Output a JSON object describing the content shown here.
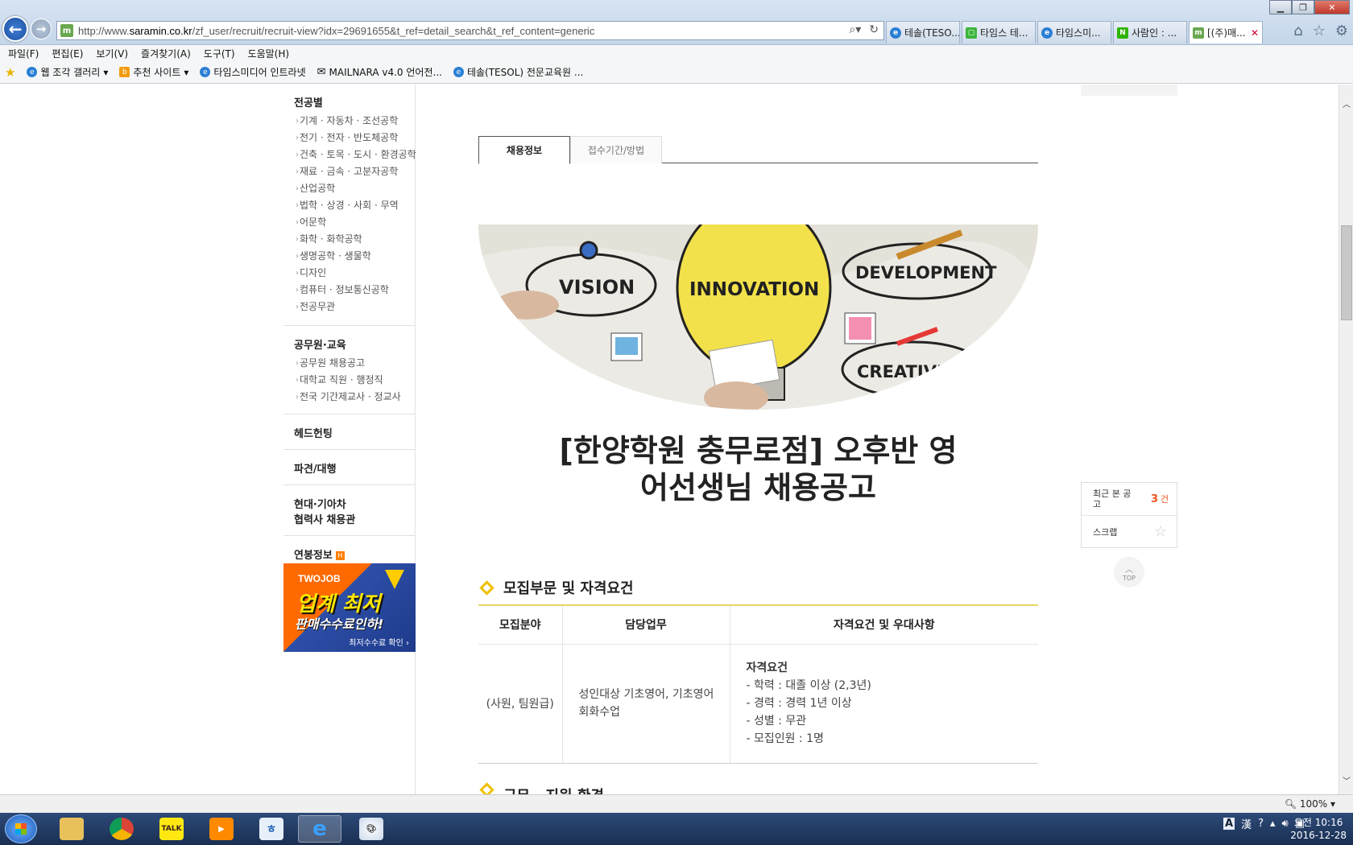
{
  "browser": {
    "url_prefix": "http://www.",
    "url_domain": "saramin.co.kr",
    "url_path": "/zf_user/recruit/recruit-view?idx=29691655&t_ref=detail_search&t_ref_content=generic",
    "tabs": [
      {
        "label": "테솔(TESO...",
        "icon": "ie-icon",
        "active": false
      },
      {
        "label": "타임스 테...",
        "icon": "line-icon",
        "active": false
      },
      {
        "label": "타임스미...",
        "icon": "ie-icon",
        "active": false
      },
      {
        "label": "사람인 : ...",
        "icon": "naver-icon",
        "active": false
      },
      {
        "label": "[(주)매...",
        "icon": "saramin-icon",
        "active": true
      }
    ],
    "menu": [
      "파일(F)",
      "편집(E)",
      "보기(V)",
      "즐겨찾기(A)",
      "도구(T)",
      "도움말(H)"
    ],
    "favorites": [
      "웹 조각 갤러리",
      "추천 사이트",
      "타임스미디어 인트라넷",
      "MAILNARA v4.0  언어전...",
      "테솔(TESOL) 전문교육원 ..."
    ],
    "zoom": "100%"
  },
  "sidebar": {
    "major_head": "전공별",
    "majors": [
      "기계 · 자동차 · 조선공학",
      "전기 · 전자 · 반도체공학",
      "건축 · 토목 · 도시 · 환경공학",
      "재료 · 금속 · 고분자공학",
      "산업공학",
      "법학 · 상경 · 사회 · 무역",
      "어문학",
      "화학 · 화학공학",
      "생명공학 · 생물학",
      "디자인",
      "컴퓨터 · 정보통신공학",
      "전공무관"
    ],
    "gov_head": "공무원·교육",
    "gov": [
      "공무원 채용공고",
      "대학교 직원 · 행정직",
      "전국 기간제교사 · 정교사"
    ],
    "headhunting": "헤드헌팅",
    "dispatch": "파견/대행",
    "hyundai_line1": "현대·기아차",
    "hyundai_line2": "협력사 채용관",
    "salary": "연봉정보",
    "salary_badge": "H",
    "ad": {
      "brand": "TWOJOB",
      "line1": "업계 최저",
      "line2": "판매수수료인하!",
      "link": "최저수수료 확인 ›"
    }
  },
  "main": {
    "tabs": [
      "채용정보",
      "접수기간/방법"
    ],
    "hero_words": [
      "VISION",
      "INNOVATION",
      "DEVELOPMENT",
      "CREATIVITY"
    ],
    "title_line1": "[한양학원 충무로점] 오후반 영",
    "title_line2": "어선생님 채용공고",
    "section_title": "모집부문 및 자격요건",
    "table": {
      "headers": [
        "모집분야",
        "담당업무",
        "자격요건 및 우대사항"
      ],
      "field": "(사원, 팀원급)",
      "duty_line1": "성인대상 기초영어, 기초영어",
      "duty_line2": "회화수업",
      "qual_head": "자격요건",
      "quals": [
        "- 학력 : 대졸 이상 (2,3년)",
        "- 경력 : 경력 1년 이상",
        "- 성별 : 무관",
        "- 모집인원 : 1명"
      ]
    },
    "next_section": "근무 · 지원 환경"
  },
  "right_panel": {
    "recent_label": "최근 본 공고",
    "recent_count": "3",
    "recent_unit": "건",
    "scrap_label": "스크랩",
    "top_label": "TOP"
  },
  "taskbar": {
    "apps": [
      "explorer",
      "chrome",
      "kakaotalk",
      "media-player",
      "hwp",
      "internet-explorer",
      "paint"
    ],
    "lang": "A",
    "hanja": "漢",
    "time": "오전 10:16",
    "date": "2016-12-28"
  }
}
